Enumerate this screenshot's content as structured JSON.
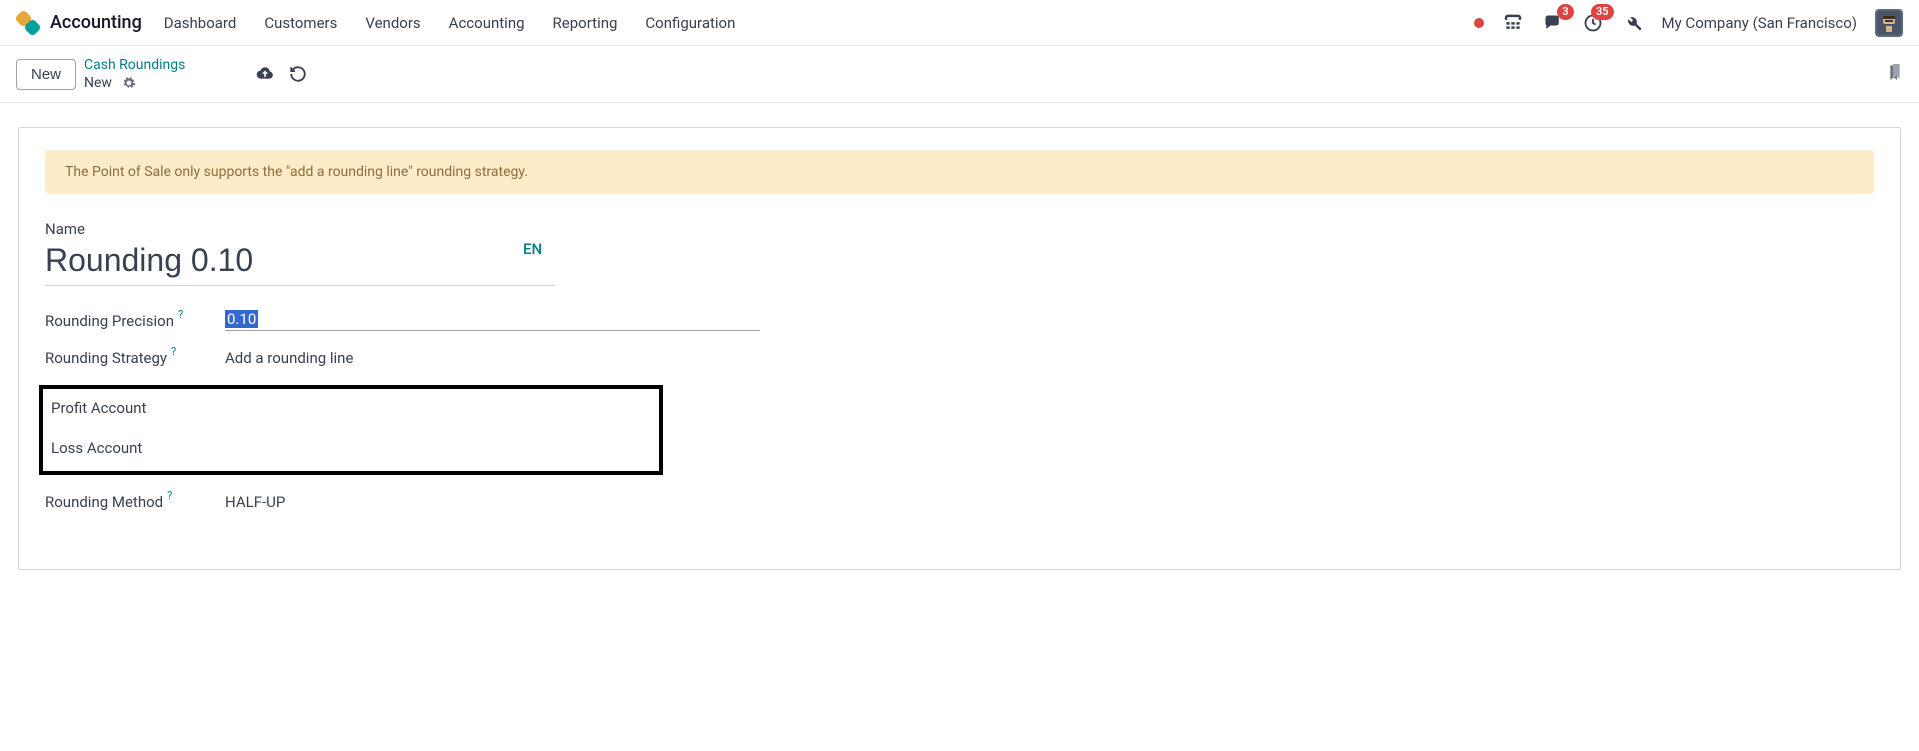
{
  "appTitle": "Accounting",
  "nav": [
    "Dashboard",
    "Customers",
    "Vendors",
    "Accounting",
    "Reporting",
    "Configuration"
  ],
  "badges": {
    "messages": "3",
    "activities": "35"
  },
  "company": "My Company (San Francisco)",
  "controlBar": {
    "newBtn": "New",
    "breadcrumbParent": "Cash Roundings",
    "breadcrumbCurrent": "New"
  },
  "alert": "The Point of Sale only supports the \"add a rounding line\" rounding strategy.",
  "form": {
    "nameLabel": "Name",
    "nameValue": "Rounding 0.10",
    "langTag": "EN",
    "precisionLabel": "Rounding Precision",
    "precisionValue": "0.10",
    "strategyLabel": "Rounding Strategy",
    "strategyValue": "Add a rounding line",
    "profitLabel": "Profit Account",
    "lossLabel": "Loss Account",
    "methodLabel": "Rounding Method",
    "methodValue": "HALF-UP",
    "help": "?"
  }
}
